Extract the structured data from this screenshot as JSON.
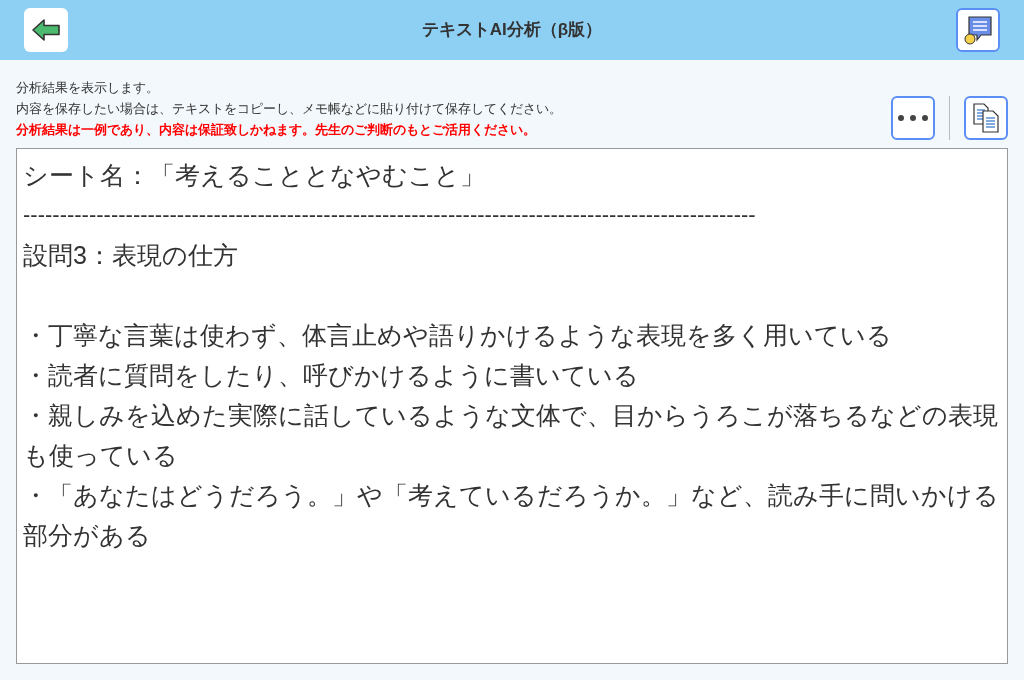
{
  "header": {
    "title": "テキストAI分析（β版）"
  },
  "notices": [
    {
      "text": "分析結果を表示します。",
      "kind": "info"
    },
    {
      "text": "内容を保存したい場合は、テキストをコピーし、メモ帳などに貼り付けて保存してください。",
      "kind": "info"
    },
    {
      "text": "分析結果は一例であり、内容は保証致しかねます。先生のご判断のもとご活用ください。",
      "kind": "warning"
    }
  ],
  "result": {
    "sheet_title": "シート名：「考えることとなやむこと」",
    "divider": "----------------------------------------------------------------------------------------------------",
    "question": "設問3：表現の仕方",
    "points": [
      "・丁寧な言葉は使わず、体言止めや語りかけるような表現を多く用いている",
      "・読者に質問をしたり、呼びかけるように書いている",
      "・親しみを込めた実際に話しているような文体で、目からうろこが落ちるなどの表現も使っている",
      "・「あなたはどうだろう。」や「考えているだろうか。」など、読み手に問いかける部分がある"
    ]
  }
}
